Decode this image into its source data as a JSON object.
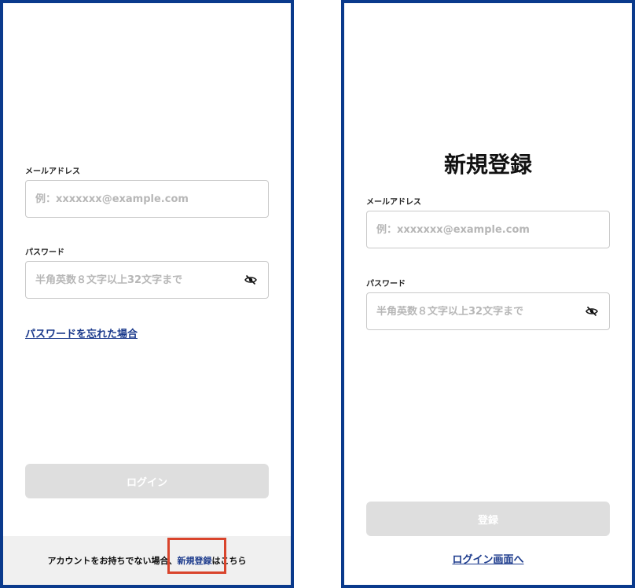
{
  "login": {
    "email_label": "メールアドレス",
    "email_placeholder": "例：xxxxxxx@example.com",
    "password_label": "パスワード",
    "password_placeholder": "半角英数８文字以上32文字まで",
    "forgot_link": "パスワードを忘れた場合",
    "login_button": "ログイン",
    "footer_prefix": "アカウントをお持ちでない場合、",
    "footer_link": "新規登録",
    "footer_suffix": "はこちら"
  },
  "register": {
    "title": "新規登録",
    "email_label": "メールアドレス",
    "email_placeholder": "例：xxxxxxx@example.com",
    "password_label": "パスワード",
    "password_placeholder": "半角英数８文字以上32文字まで",
    "submit_button": "登録",
    "back_link": "ログイン画面へ"
  },
  "icons": {
    "password_toggle": "eye-slash-icon"
  },
  "colors": {
    "frame_border": "#0a3a8c",
    "link": "#1b3a8c",
    "disabled_button": "#dedede",
    "highlight": "#d9442c"
  }
}
